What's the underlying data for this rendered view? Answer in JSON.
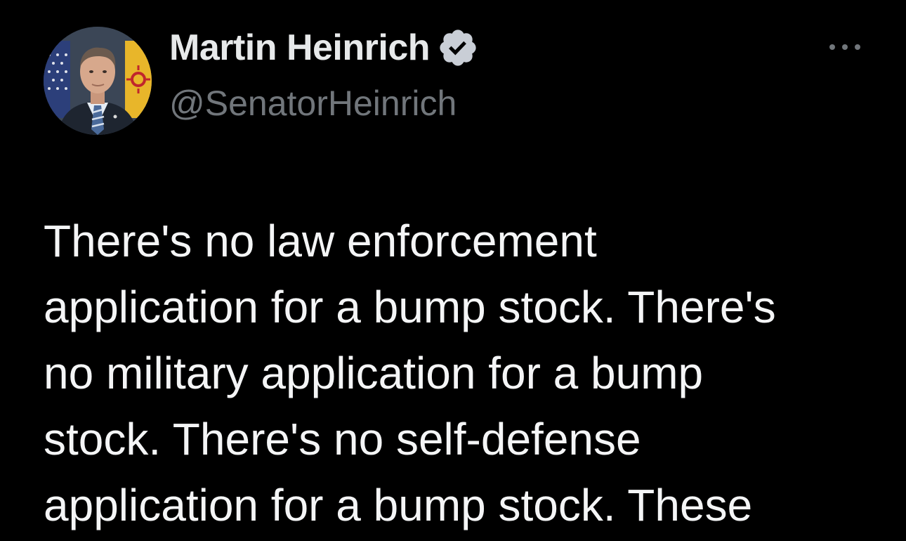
{
  "author": {
    "display_name": "Martin Heinrich",
    "handle": "@SenatorHeinrich",
    "verified": true,
    "avatar_icon": "profile-photo"
  },
  "actions": {
    "more_icon": "more-horizontal-icon"
  },
  "tweet": {
    "text": "There's no law enforcement\napplication for a bump stock. There's\nno military application for a bump\nstock. There's no self-defense\napplication for a bump stock. These"
  },
  "colors": {
    "background": "#000000",
    "primary_text": "#e7e9ea",
    "secondary_text": "#71767b",
    "verified_badge": "#c9ced6"
  }
}
